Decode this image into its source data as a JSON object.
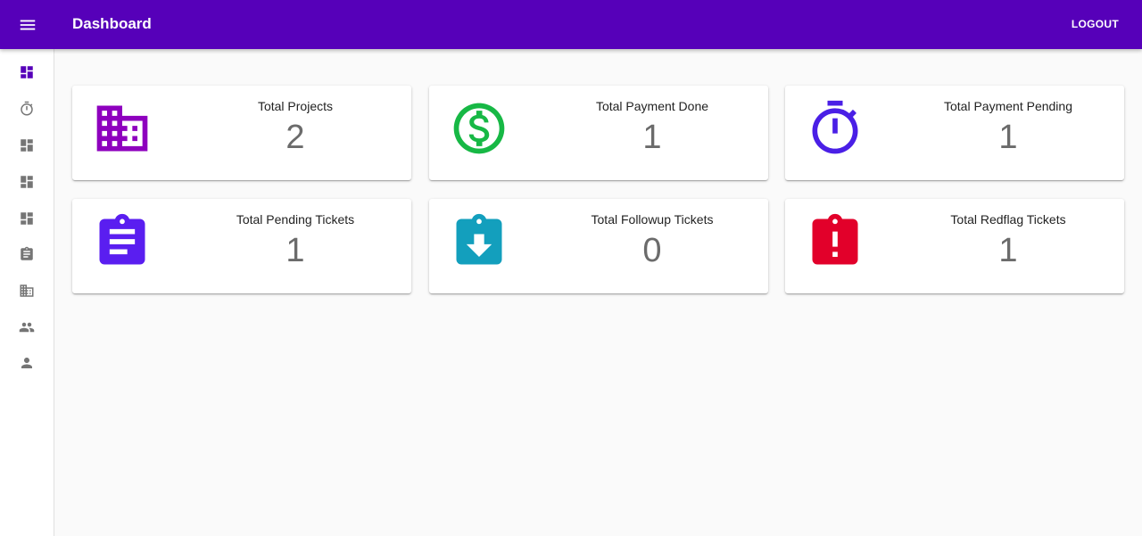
{
  "appbar": {
    "title": "Dashboard",
    "logout_label": "LOGOUT",
    "menu_icon": "menu-icon",
    "color": "#5600b9"
  },
  "sidebar": {
    "items": [
      {
        "icon": "dashboard-icon",
        "active": true
      },
      {
        "icon": "timer-icon"
      },
      {
        "icon": "dashboard-icon"
      },
      {
        "icon": "dashboard-icon"
      },
      {
        "icon": "dashboard-icon"
      },
      {
        "icon": "assignment-icon"
      },
      {
        "icon": "business-icon"
      },
      {
        "icon": "people-icon"
      },
      {
        "icon": "person-icon"
      }
    ],
    "active_color": "#5600b9",
    "inactive_color": "#757575"
  },
  "cards": [
    {
      "label": "Total Projects",
      "value": "2",
      "icon": "business-icon",
      "color": "#8e00be"
    },
    {
      "label": "Total Payment Done",
      "value": "1",
      "icon": "monetization-icon",
      "color": "#17b845"
    },
    {
      "label": "Total Payment Pending",
      "value": "1",
      "icon": "timer-icon",
      "color": "#4a1fe6"
    },
    {
      "label": "Total Pending Tickets",
      "value": "1",
      "icon": "assignment-icon",
      "color": "#5a1ef0"
    },
    {
      "label": "Total Followup Tickets",
      "value": "0",
      "icon": "assignment-returned-icon",
      "color": "#139fbd"
    },
    {
      "label": "Total Redflag Tickets",
      "value": "1",
      "icon": "assignment-late-icon",
      "color": "#e2002a"
    }
  ]
}
